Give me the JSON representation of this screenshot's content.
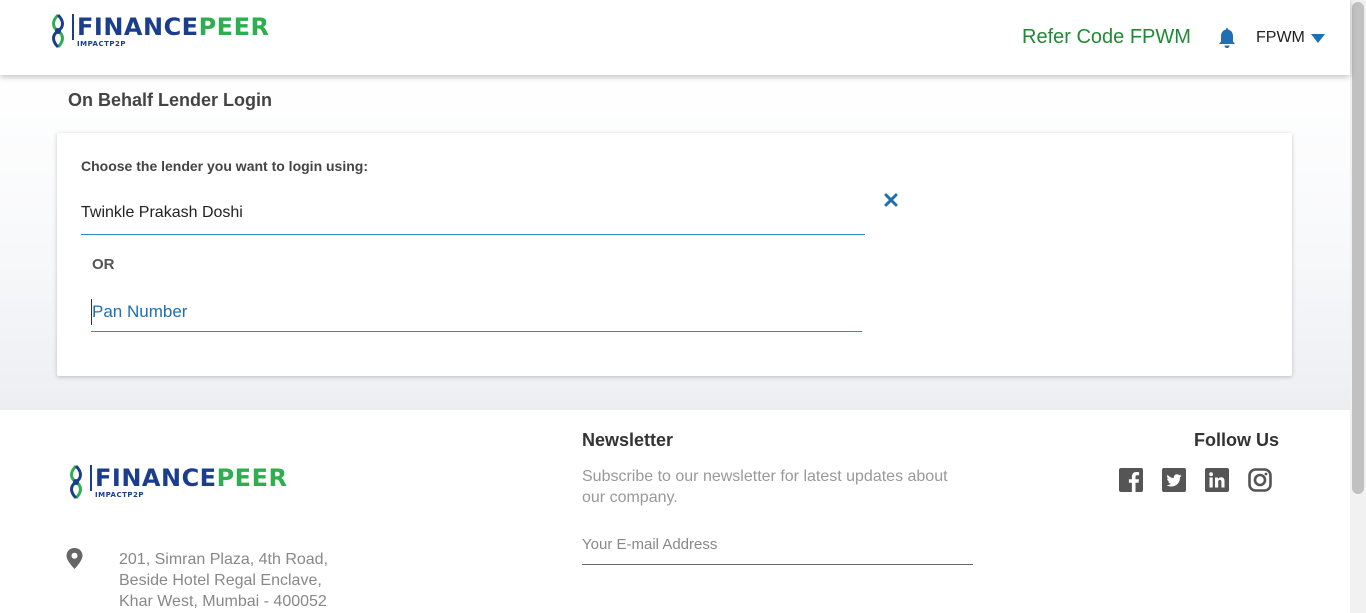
{
  "header": {
    "logo": {
      "word_part1": "FINANCE",
      "word_part2": "PEER",
      "sub": "IMPACTP2P"
    },
    "refer_code": "Refer Code FPWM",
    "user_name": "FPWM",
    "icons": {
      "notifications": "bell-icon",
      "menu": "caret-down-icon"
    }
  },
  "main": {
    "page_title": "On Behalf Lender Login",
    "choose_label": "Choose the lender you want to login using:",
    "lender_value": "Twinkle Prakash Doshi",
    "clear_icon": "close-icon",
    "or_label": "OR",
    "pan_placeholder": "Pan Number",
    "pan_value": ""
  },
  "footer": {
    "logo": {
      "word_part1": "FINANCE",
      "word_part2": "PEER",
      "sub": "IMPACTP2P"
    },
    "address_lines": [
      "201, Simran Plaza, 4th Road,",
      "Beside Hotel Regal Enclave,",
      "Khar West, Mumbai - 400052"
    ],
    "newsletter_title": "Newsletter",
    "newsletter_desc": "Subscribe to our newsletter for latest updates about our company.",
    "email_placeholder": "Your E-mail Address",
    "follow_title": "Follow Us",
    "social_icons": [
      "facebook-icon",
      "twitter-icon",
      "linkedin-icon",
      "instagram-icon"
    ]
  },
  "colors": {
    "brand_blue": "#1a3e8c",
    "brand_green": "#2eae4e",
    "refer_green": "#1e8a35",
    "accent_blue": "#1f6fb2",
    "input_underline": "#2c8ac9"
  }
}
